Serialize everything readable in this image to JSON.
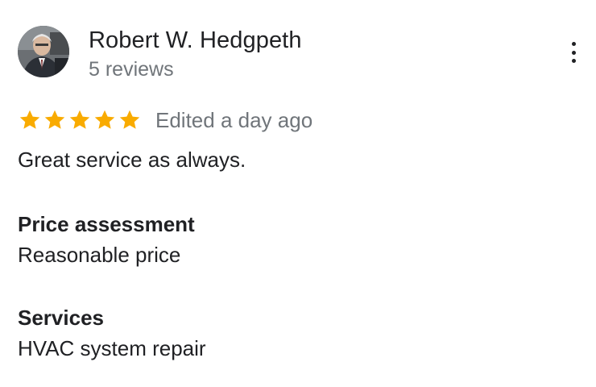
{
  "review": {
    "author": {
      "name": "Robert W. Hedgpeth",
      "reviews_count": "5 reviews",
      "avatar": "avatar-photo"
    },
    "menu_icon": "more-vert-icon",
    "rating": {
      "stars": 5,
      "max": 5,
      "star_color": "#f9ab00",
      "star_icon": "star-icon"
    },
    "timestamp": "Edited a day ago",
    "text": "Great service as always.",
    "attributes": [
      {
        "label": "Price assessment",
        "value": "Reasonable price"
      },
      {
        "label": "Services",
        "value": "HVAC system repair"
      }
    ]
  }
}
